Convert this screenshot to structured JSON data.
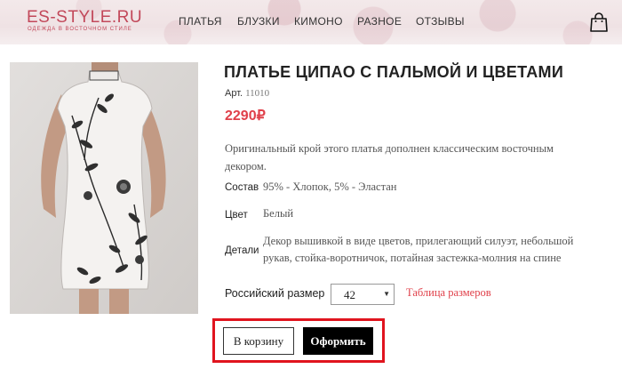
{
  "header": {
    "logo": "ES-STYLE.RU",
    "logo_tagline": "ОДЕЖДА В ВОСТОЧНОМ СТИЛЕ",
    "nav": [
      {
        "label": "ПЛАТЬЯ"
      },
      {
        "label": "БЛУЗКИ"
      },
      {
        "label": "КИМОНО"
      },
      {
        "label": "РАЗНОЕ"
      },
      {
        "label": "ОТЗЫВЫ"
      }
    ],
    "cart_icon": "shopping-bag-icon"
  },
  "product": {
    "image_icon": "dress-photo",
    "title": "ПЛАТЬЕ ЦИПАО С ПАЛЬМОЙ И ЦВЕТАМИ",
    "article_label": "Арт.",
    "article_value": "11010",
    "price": "2290₽",
    "description_line1": "Оригинальный крой этого платья дополнен классическим восточным",
    "description_line2": "декором.",
    "composition_label": "Состав",
    "composition_value": "95% - Хлопок, 5% - Эластан",
    "color_label": "Цвет",
    "color_value": "Белый",
    "details_label": "Детали",
    "details_line1": "Декор вышивкой в виде цветов, прилегающий силуэт, небольшой",
    "details_line2": "рукав, стойка-воротничок, потайная застежка-молния на спине",
    "size_label": "Российский размер",
    "size_value": "42",
    "size_table_link": "Таблица размеров",
    "add_to_cart": "В корзину",
    "checkout": "Оформить"
  },
  "colors": {
    "accent": "#e0404a",
    "logo": "#c2485a",
    "highlight": "#e0141e",
    "button_dark": "#000000"
  }
}
